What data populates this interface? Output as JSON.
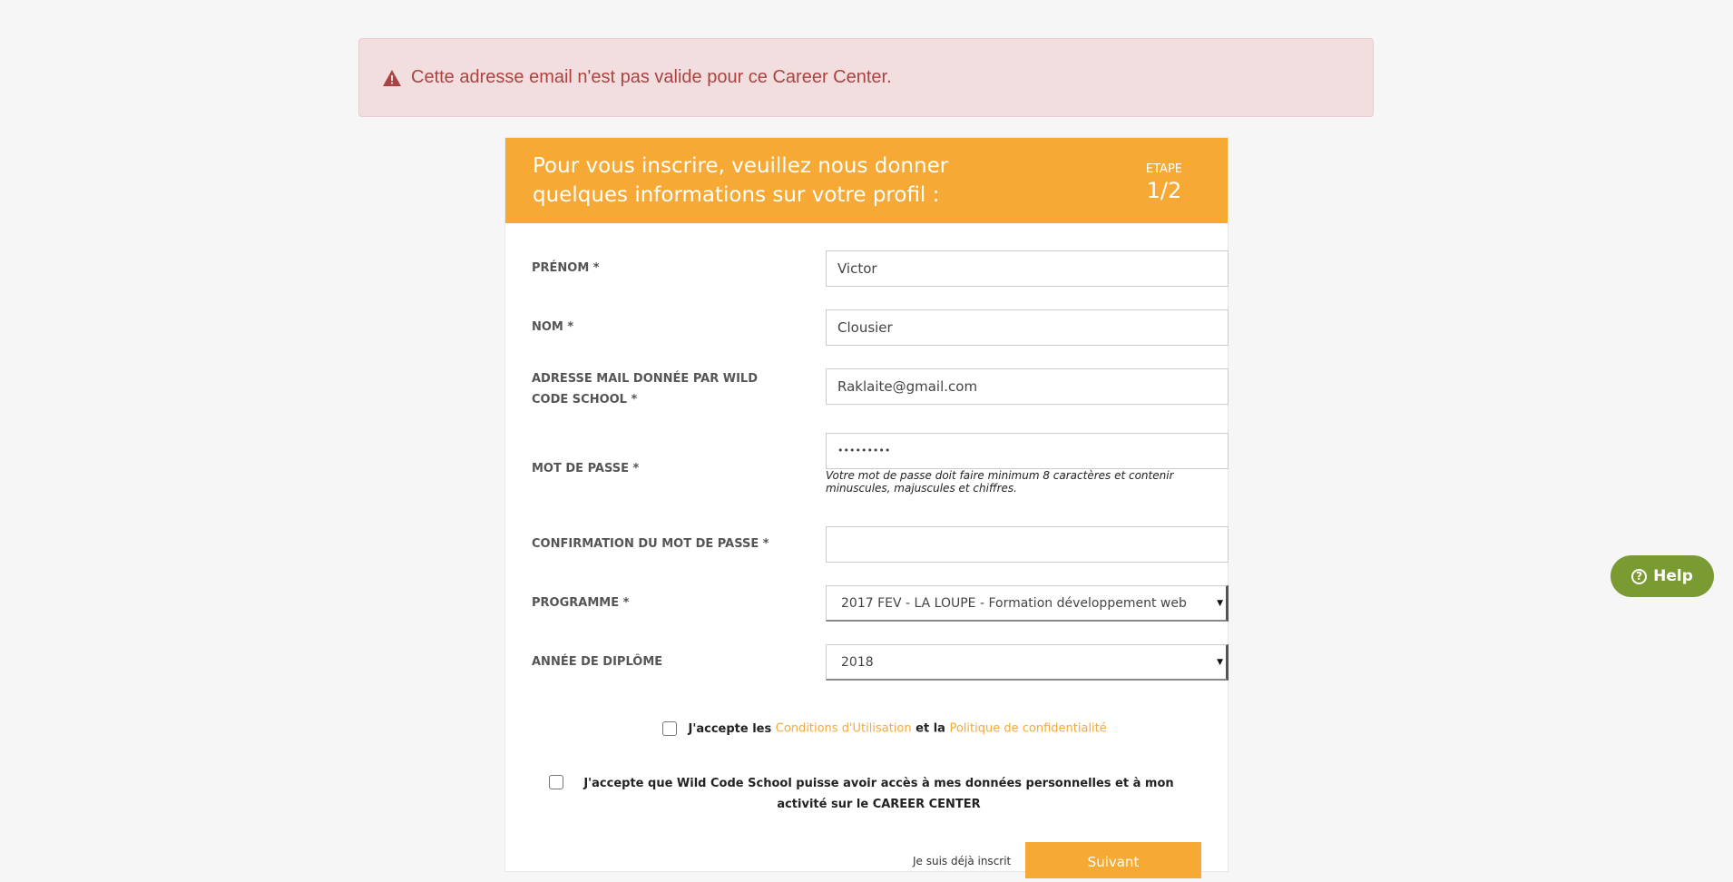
{
  "alert": {
    "message": "Cette adresse email n'est pas valide pour ce Career Center."
  },
  "header": {
    "title": "Pour vous inscrire, veuillez nous donner quelques informations sur votre profil :",
    "step_label": "ETAPE",
    "step_value": "1/2"
  },
  "form": {
    "prenom": {
      "label": "PRÉNOM *",
      "value": "Victor"
    },
    "nom": {
      "label": "NOM *",
      "value": "Clousier"
    },
    "email": {
      "label": "ADRESSE MAIL DONNÉE PAR WILD CODE SCHOOL *",
      "value": "Raklaite@gmail.com"
    },
    "password": {
      "label": "MOT DE PASSE *",
      "value": "•••••••••",
      "hint": "Votre mot de passe doit faire minimum 8 caractères et contenir minuscules, majuscules et chiffres."
    },
    "password_confirm": {
      "label": "CONFIRMATION DU MOT DE PASSE *",
      "value": ""
    },
    "programme": {
      "label": "PROGRAMME *",
      "selected": "2017 FEV - LA LOUPE - Formation développement web"
    },
    "annee": {
      "label": "ANNÉE DE DIPLÔME",
      "selected": "2018"
    }
  },
  "consent": {
    "terms_prefix": "J'accepte les",
    "terms_link": "Conditions d'Utilisation",
    "terms_and": "et la",
    "privacy_link": "Politique de confidentialité",
    "data_access": "J'accepte que Wild Code School puisse avoir accès à mes données personnelles et à mon activité sur le CAREER CENTER"
  },
  "actions": {
    "login_link": "Je suis déjà inscrit",
    "next_label": "Suivant"
  },
  "help": {
    "label": "Help"
  },
  "colors": {
    "accent": "#f6a935",
    "alert_text": "#a94442",
    "help_green": "#7a9a32"
  },
  "icons": [
    "warning-icon",
    "question-icon",
    "dropdown-caret-icon"
  ]
}
